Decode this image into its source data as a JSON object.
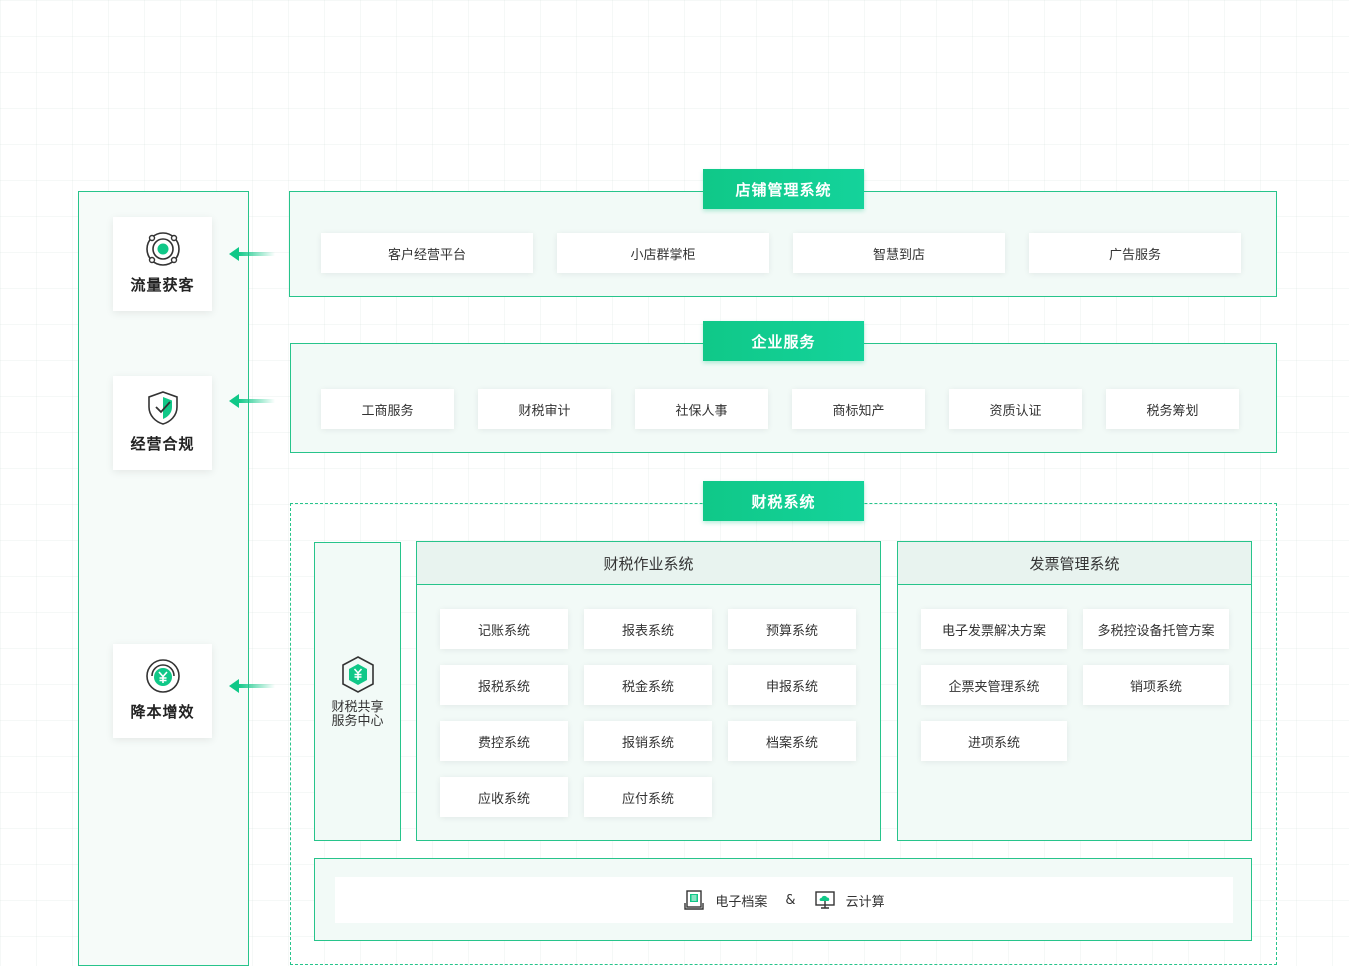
{
  "colors": {
    "accent": "#10c888",
    "border": "#27c48b",
    "panel": "#f2faf7"
  },
  "capabilities": [
    {
      "label": "流量获客",
      "icon": "target-icon"
    },
    {
      "label": "经营合规",
      "icon": "shield-check-icon"
    },
    {
      "label": "降本增效",
      "icon": "yuan-coin-icon"
    }
  ],
  "store_mgmt": {
    "title": "店铺管理系统",
    "items": [
      "客户经营平台",
      "小店群掌柜",
      "智慧到店",
      "广告服务"
    ]
  },
  "enterprise": {
    "title": "企业服务",
    "items": [
      "工商服务",
      "财税审计",
      "社保人事",
      "商标知产",
      "资质认证",
      "税务筹划"
    ]
  },
  "finance_tax": {
    "title": "财税系统",
    "shared_center": {
      "line1": "财税共享",
      "line2": "服务中心",
      "icon": "yuan-cube-icon"
    },
    "operations": {
      "title": "财税作业系统",
      "items": [
        "记账系统",
        "报表系统",
        "预算系统",
        "报税系统",
        "税金系统",
        "申报系统",
        "费控系统",
        "报销系统",
        "档案系统",
        "应收系统",
        "应付系统"
      ]
    },
    "invoice": {
      "title": "发票管理系统",
      "items": [
        "电子发票解决方案",
        "多税控设备托管方案",
        "企票夹管理系统",
        "销项系统",
        "进项系统"
      ]
    },
    "infra": {
      "archive_label": "电子档案",
      "archive_icon": "document-archive-icon",
      "amp": "&",
      "cloud_label": "云计算",
      "cloud_icon": "cloud-monitor-icon"
    }
  }
}
